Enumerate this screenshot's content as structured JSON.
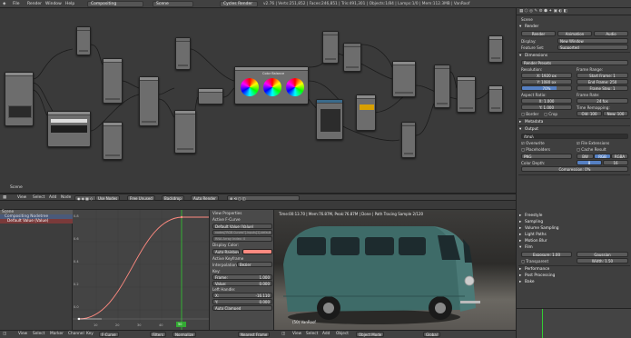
{
  "topbar": {
    "menus": [
      "File",
      "Render",
      "Window",
      "Help"
    ],
    "editor_type": "Compositing",
    "scene": "Scene",
    "engine": "Cycles Render",
    "stats": "v2.76 | Verts:251,852 | Faces:246,851 | Tris:491,301 | Objects:1/84 | Lamps:1/0 | Mem:112.3MB | VanRoof"
  },
  "node_editor": {
    "corner_label": "Scene",
    "color_balance_title": "Color Balance",
    "header": {
      "menus": [
        "View",
        "Select",
        "Add",
        "Node"
      ],
      "use_nodes": "Use Nodes",
      "free_unused": "Free Unused",
      "backdrop": "Backdrop",
      "auto_render": "Auto Render"
    }
  },
  "outliner": {
    "items": [
      "Scene",
      "Compositing Nodetree",
      "Default Value (Value)"
    ]
  },
  "graph": {
    "y_ticks": [
      "0.8",
      "0.6",
      "0.4",
      "0.2",
      "0.0"
    ],
    "x_ticks": [
      "10",
      "20",
      "30",
      "40",
      "50"
    ],
    "current_frame": "50"
  },
  "fcurve_panel": {
    "view_properties": "View Properties",
    "active_fcurve": "Active F-Curve",
    "fcurve_name": "Default Value (Value)",
    "rna_path": "nodes[\"RGB Curves\"].inputs[1].default_value",
    "array_index": "RNA Array Index: 0",
    "display_color": "Display Color:",
    "display_color_mode": "Auto Rainbow",
    "active_keyframe": "Active Keyframe",
    "interpolation_label": "Interpolation:",
    "interpolation": "Bezier",
    "key_label": "Key:",
    "frame_label": "Frame:",
    "frame_value": "1.000",
    "value_label": "Value:",
    "value_value": "0.000",
    "left_handle": "Left Handle:",
    "lh_x_label": "X:",
    "lh_x": "-16.110",
    "lh_y_label": "Y:",
    "lh_y": "0.000",
    "handle_type": "Auto Clamped"
  },
  "render_view": {
    "status": "Time:00:13.70 | Mem:76.87M, Peak:76.87M | Done | Path Tracing Sample 2/120",
    "label": "(50) VanRoof"
  },
  "bottom_header": {
    "left": [
      "View",
      "Select",
      "Marker",
      "Channel",
      "Key",
      "F-Curve"
    ],
    "filters": "Filters",
    "normalize": "Normalize",
    "snap": "Nearest Frame",
    "right": [
      "View",
      "Select",
      "Add",
      "Object"
    ],
    "mode": "Object Mode",
    "shading": "Global"
  },
  "properties": {
    "scene_path": "Scene",
    "render_section": "Render",
    "render_btn": "Render",
    "animation_btn": "Animation",
    "audio_btn": "Audio",
    "display_label": "Display:",
    "display_value": "New Window",
    "feature_label": "Feature Set:",
    "feature_value": "Supported",
    "dimensions": "Dimensions",
    "render_presets": "Render Presets",
    "resolution": "Resolution:",
    "res_x": "X: 1920 px",
    "res_y": "Y: 1080 px",
    "res_pct": "70%",
    "frame_range": "Frame Range:",
    "start_frame": "Start Frame: 1",
    "end_frame": "End Frame: 250",
    "frame_step": "Frame Step: 1",
    "aspect_ratio": "Aspect Ratio:",
    "asp_x": "X: 1.000",
    "asp_y": "Y: 1.000",
    "frame_rate": "Frame Rate:",
    "fps": "24 fps",
    "time_remap": "Time Remapping:",
    "remap_old": "Old: 100",
    "remap_new": "New: 100",
    "border": "Border",
    "crop": "Crop",
    "metadata": "Metadata",
    "output": "Output",
    "output_path": "/tmp\\",
    "overwrite": "Overwrite",
    "file_ext": "File Extensions",
    "placeholders": "Placeholders",
    "cache_result": "Cache Result",
    "format": "PNG",
    "bw": "BW",
    "rgb": "RGB",
    "rgba": "RGBA",
    "color_depth": "Color Depth:",
    "depth8": "8",
    "depth16": "16",
    "compression": "Compression:",
    "compression_value": "0%",
    "freestyle": "Freestyle",
    "sampling": "Sampling",
    "volume_sampling": "Volume Sampling",
    "light_paths": "Light Paths",
    "motion_blur": "Motion Blur",
    "film": "Film",
    "exposure": "Exposure: 1.00",
    "filter": "Gaussian",
    "transparent": "Transparent",
    "width": "Width: 1.50",
    "performance": "Performance",
    "post_processing": "Post Processing",
    "bake": "Bake"
  },
  "colors": {
    "accent": "#5680c2",
    "curve": "#ff8a80",
    "frame_line": "#33cc33"
  }
}
